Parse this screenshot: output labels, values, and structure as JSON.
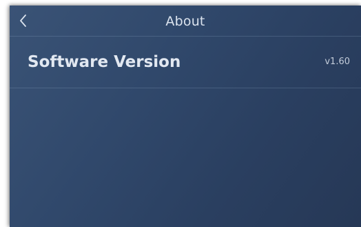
{
  "header": {
    "title": "About",
    "back_icon": "chevron-left-icon"
  },
  "settings": {
    "items": [
      {
        "label": "Software Version",
        "value": "v1.60"
      }
    ]
  },
  "colors": {
    "background_top": "#3a5376",
    "background_bottom": "#263856",
    "text_primary": "#e2e8f1",
    "text_secondary": "#c3ccd9"
  }
}
